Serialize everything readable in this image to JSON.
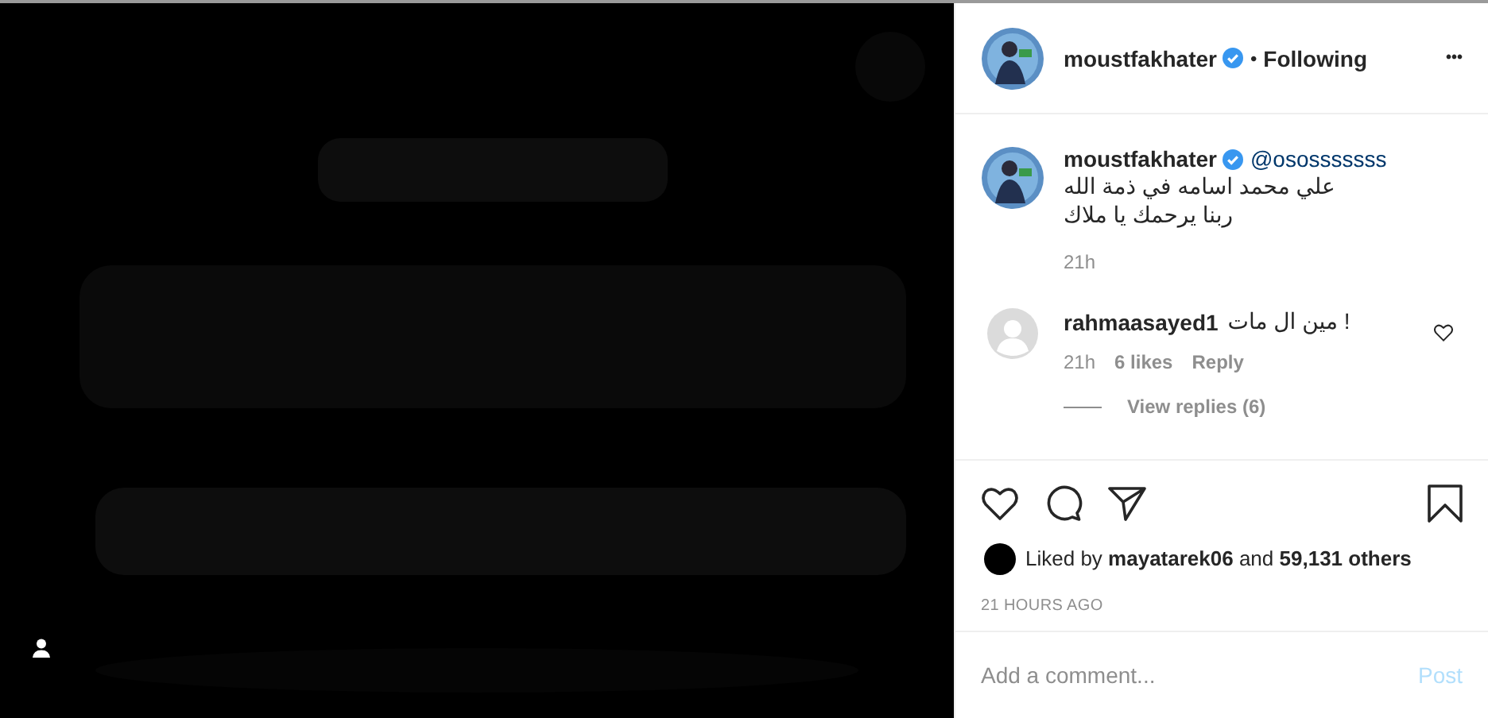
{
  "header": {
    "username": "moustfakhater",
    "verified": true,
    "separator": "•",
    "follow_state": "Following",
    "more": "•••"
  },
  "caption": {
    "username": "moustfakhater",
    "verified": true,
    "mention": "@ososssssss",
    "lines": [
      "علي محمد اسامه في ذمة الله",
      "ربنا يرحمك يا ملاك"
    ],
    "time": "21h"
  },
  "comments": [
    {
      "username": "rahmaasayed1",
      "text": "! مين ال مات",
      "time": "21h",
      "likes": "6 likes",
      "reply": "Reply",
      "liked": false,
      "view_replies": "View replies (6)"
    }
  ],
  "actions": {
    "liked": false,
    "saved": false
  },
  "likes": {
    "prefix": "Liked by",
    "user": "mayatarek06",
    "middle": "and",
    "count": "59,131 others"
  },
  "timestamp": "21 HOURS AGO",
  "add_comment": {
    "placeholder": "Add a comment...",
    "post": "Post",
    "disabled": true
  }
}
